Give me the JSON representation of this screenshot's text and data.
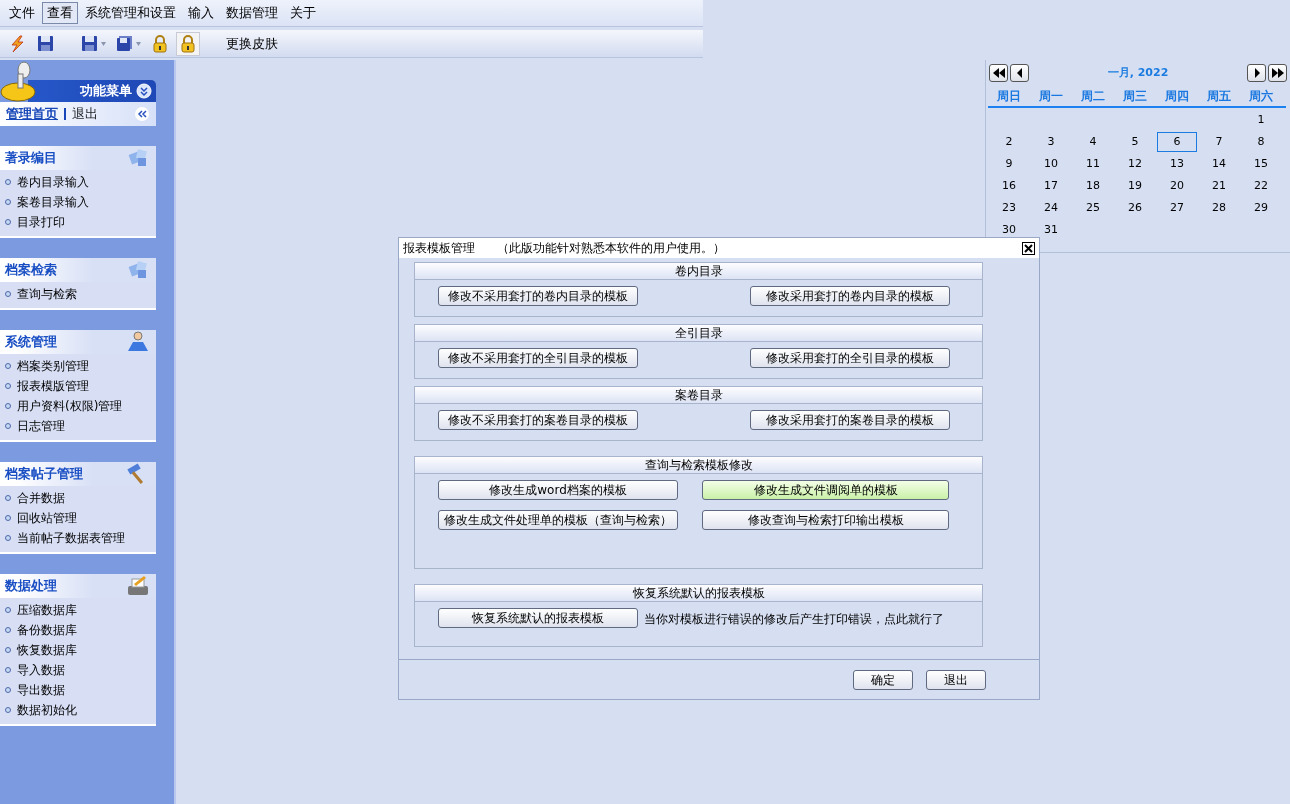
{
  "menubar": [
    {
      "label": "文件",
      "selected": false
    },
    {
      "label": "查看",
      "selected": true
    },
    {
      "label": "系统管理和设置",
      "selected": false
    },
    {
      "label": "输入",
      "selected": false
    },
    {
      "label": "数据管理",
      "selected": false
    },
    {
      "label": "关于",
      "selected": false
    }
  ],
  "toolbar": [
    {
      "kind": "lightning",
      "pressed": false
    },
    {
      "kind": "save",
      "pressed": false
    },
    {
      "kind": "separator"
    },
    {
      "kind": "savemenu",
      "pressed": false
    },
    {
      "kind": "saveasmenu",
      "pressed": false
    },
    {
      "kind": "lock",
      "pressed": false
    },
    {
      "kind": "lock",
      "pressed": true
    },
    {
      "kind": "text",
      "label": "更换皮肤"
    }
  ],
  "sidebar": {
    "title": "功能菜单",
    "home": "管理首页",
    "logout": "退出",
    "sections": [
      {
        "title": "著录编目",
        "kind": "cubes",
        "items": [
          "卷内目录输入",
          "案卷目录输入",
          "目录打印"
        ]
      },
      {
        "title": "档案检索",
        "kind": "cubes",
        "items": [
          "查询与检索"
        ]
      },
      {
        "title": "系统管理",
        "kind": "person",
        "items": [
          "档案类别管理",
          "报表模版管理",
          "用户资料(权限)管理",
          "日志管理"
        ]
      },
      {
        "title": "档案帖子管理",
        "kind": "hammer",
        "items": [
          "合并数据",
          "回收站管理",
          "当前帖子数据表管理"
        ]
      },
      {
        "title": "数据处理",
        "kind": "printer",
        "items": [
          "压缩数据库",
          "备份数据库",
          "恢复数据库",
          "导入数据",
          "导出数据",
          "数据初始化"
        ]
      }
    ]
  },
  "calendar": {
    "month": "一月, 2022",
    "weekdays": [
      "周日",
      "周一",
      "周二",
      "周三",
      "周四",
      "周五",
      "周六"
    ],
    "weeks": [
      [
        {
          "day": "1",
          "selected": false
        }
      ],
      [
        {
          "day": "2",
          "selected": false
        },
        {
          "day": "3",
          "selected": false
        },
        {
          "day": "4",
          "selected": false
        },
        {
          "day": "5",
          "selected": false
        },
        {
          "day": "6",
          "selected": true
        },
        {
          "day": "7",
          "selected": false
        },
        {
          "day": "8",
          "selected": false
        }
      ],
      [
        {
          "day": "9",
          "selected": false
        },
        {
          "day": "10",
          "selected": false
        },
        {
          "day": "11",
          "selected": false
        },
        {
          "day": "12",
          "selected": false
        },
        {
          "day": "13",
          "selected": false
        },
        {
          "day": "14",
          "selected": false
        },
        {
          "day": "15",
          "selected": false
        }
      ],
      [
        {
          "day": "16",
          "selected": false
        },
        {
          "day": "17",
          "selected": false
        },
        {
          "day": "18",
          "selected": false
        },
        {
          "day": "19",
          "selected": false
        },
        {
          "day": "20",
          "selected": false
        },
        {
          "day": "21",
          "selected": false
        },
        {
          "day": "22",
          "selected": false
        }
      ],
      [
        {
          "day": "23",
          "selected": false
        },
        {
          "day": "24",
          "selected": false
        },
        {
          "day": "25",
          "selected": false
        },
        {
          "day": "26",
          "selected": false
        },
        {
          "day": "27",
          "selected": false
        },
        {
          "day": "28",
          "selected": false
        },
        {
          "day": "29",
          "selected": false
        }
      ],
      [
        {
          "day": "30",
          "selected": false
        },
        {
          "day": "31",
          "selected": false
        }
      ]
    ]
  },
  "dialog": {
    "title": "报表模板管理",
    "note": "（此版功能针对熟悉本软件的用户使用。）",
    "groups": [
      {
        "title": "卷内目录",
        "buttons": [
          {
            "label": "修改不采用套打的卷内目录的模板",
            "highlighted": false
          },
          {
            "label": "修改采用套打的卷内目录的模板",
            "highlighted": false
          }
        ]
      },
      {
        "title": "全引目录",
        "buttons": [
          {
            "label": "修改不采用套打的全引目录的模板",
            "highlighted": false
          },
          {
            "label": "修改采用套打的全引目录的模板",
            "highlighted": false
          }
        ]
      },
      {
        "title": "案卷目录",
        "buttons": [
          {
            "label": "修改不采用套打的案卷目录的模板",
            "highlighted": false
          },
          {
            "label": "修改采用套打的案卷目录的模板",
            "highlighted": false
          }
        ]
      },
      {
        "title": "查询与检索模板修改",
        "kind": "grid",
        "buttons": [
          {
            "label": "修改生成word档案的模板",
            "highlighted": false
          },
          {
            "label": "修改生成文件调阅单的模板",
            "highlighted": true
          },
          {
            "label": "修改生成文件处理单的模板（查询与检索）",
            "highlighted": false
          },
          {
            "label": "修改查询与检索打印输出模板",
            "highlighted": false
          }
        ]
      },
      {
        "title": "恢复系统默认的报表模板",
        "buttons": [
          {
            "label": "恢复系统默认的报表模板",
            "highlighted": false
          }
        ],
        "hint": "当你对模板进行错误的修改后产生打印错误，点此就行了"
      }
    ],
    "footer_buttons": [
      "确定",
      "退出"
    ]
  }
}
